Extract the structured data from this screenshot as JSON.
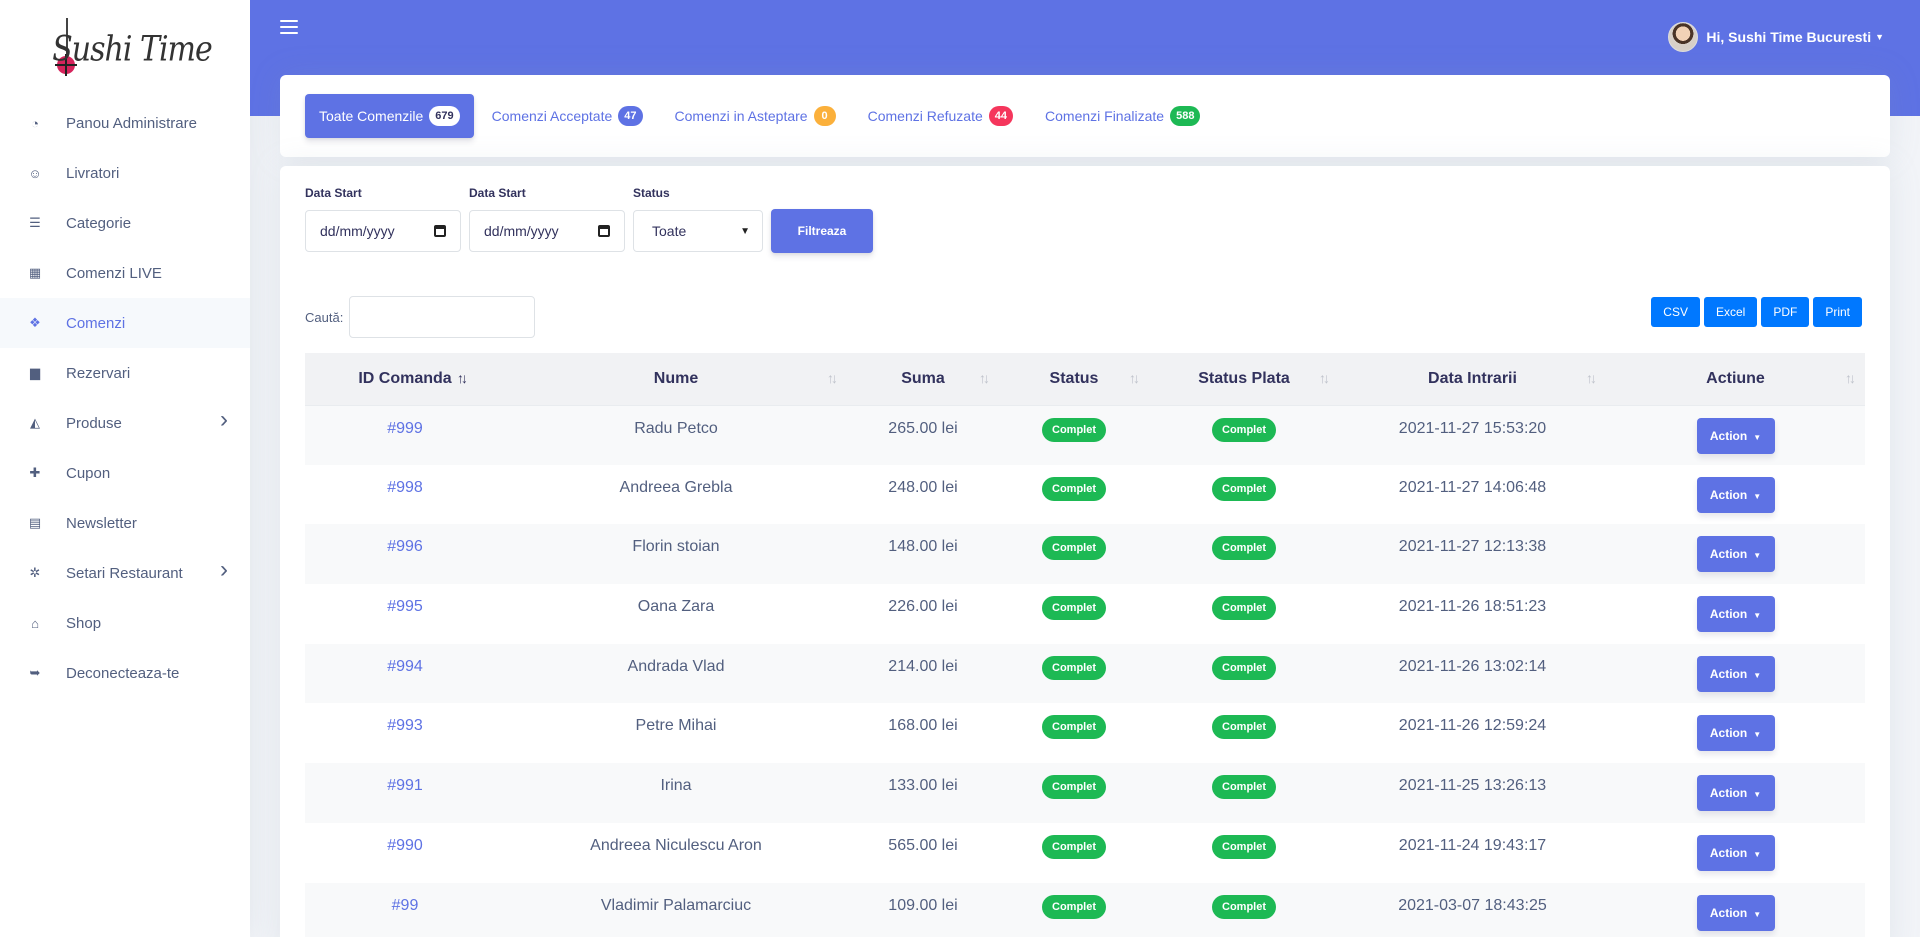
{
  "brand": {
    "logo_text": "Sushi Time"
  },
  "sidebar": {
    "items": [
      {
        "label": "Panou Administrare",
        "icon": "dashboard-icon",
        "glyph": "◔"
      },
      {
        "label": "Livratori",
        "icon": "user-icon",
        "glyph": "☺"
      },
      {
        "label": "Categorie",
        "icon": "list-icon",
        "glyph": "☰"
      },
      {
        "label": "Comenzi LIVE",
        "icon": "grid-icon",
        "glyph": "▦"
      },
      {
        "label": "Comenzi",
        "icon": "cubes-icon",
        "glyph": "❖",
        "active": true
      },
      {
        "label": "Rezervari",
        "icon": "calendar-icon",
        "glyph": "▆"
      },
      {
        "label": "Produse",
        "icon": "pizza-icon",
        "glyph": "◭",
        "chevron": true
      },
      {
        "label": "Cupon",
        "icon": "gift-icon",
        "glyph": "✚"
      },
      {
        "label": "Newsletter",
        "icon": "newspaper-icon",
        "glyph": "▤"
      },
      {
        "label": "Setari Restaurant",
        "icon": "gears-icon",
        "glyph": "✲",
        "chevron": true
      },
      {
        "label": "Shop",
        "icon": "store-icon",
        "glyph": "⌂"
      },
      {
        "label": "Deconecteaza-te",
        "icon": "logout-icon",
        "glyph": "➥"
      }
    ]
  },
  "header": {
    "user_greeting": "Hi, Sushi Time Bucuresti"
  },
  "tabs": [
    {
      "label": "Toate Comenzile",
      "count": "679",
      "color": "#ffffff",
      "active": true
    },
    {
      "label": "Comenzi Acceptate",
      "count": "47",
      "color": "#5e72e4"
    },
    {
      "label": "Comenzi in Asteptare",
      "count": "0",
      "color": "#fbb03b"
    },
    {
      "label": "Comenzi Refuzate",
      "count": "44",
      "color": "#f5365c"
    },
    {
      "label": "Comenzi Finalizate",
      "count": "588",
      "color": "#1db954"
    }
  ],
  "filters": {
    "start_label": "Data Start",
    "end_label": "Data Start",
    "date_placeholder": "dd/mm/yyyy",
    "status_label": "Status",
    "status_value": "Toate",
    "submit_label": "Filtreaza"
  },
  "search": {
    "label": "Caută:"
  },
  "export_buttons": [
    "CSV",
    "Excel",
    "PDF",
    "Print"
  ],
  "table": {
    "columns": [
      "ID Comanda",
      "Nume",
      "Suma",
      "Status",
      "Status Plata",
      "Data Intrarii",
      "Actiune"
    ],
    "action_label": "Action",
    "rows": [
      {
        "id": "#999",
        "name": "Radu Petco",
        "sum": "265.00 lei",
        "status": "Complet",
        "pay": "Complet",
        "date": "2021-11-27 15:53:20"
      },
      {
        "id": "#998",
        "name": "Andreea Grebla",
        "sum": "248.00 lei",
        "status": "Complet",
        "pay": "Complet",
        "date": "2021-11-27 14:06:48"
      },
      {
        "id": "#996",
        "name": "Florin stoian",
        "sum": "148.00 lei",
        "status": "Complet",
        "pay": "Complet",
        "date": "2021-11-27 12:13:38"
      },
      {
        "id": "#995",
        "name": "Oana Zara",
        "sum": "226.00 lei",
        "status": "Complet",
        "pay": "Complet",
        "date": "2021-11-26 18:51:23"
      },
      {
        "id": "#994",
        "name": "Andrada Vlad",
        "sum": "214.00 lei",
        "status": "Complet",
        "pay": "Complet",
        "date": "2021-11-26 13:02:14"
      },
      {
        "id": "#993",
        "name": "Petre Mihai",
        "sum": "168.00 lei",
        "status": "Complet",
        "pay": "Complet",
        "date": "2021-11-26 12:59:24"
      },
      {
        "id": "#991",
        "name": "Irina",
        "sum": "133.00 lei",
        "status": "Complet",
        "pay": "Complet",
        "date": "2021-11-25 13:26:13"
      },
      {
        "id": "#990",
        "name": "Andreea Niculescu Aron",
        "sum": "565.00 lei",
        "status": "Complet",
        "pay": "Complet",
        "date": "2021-11-24 19:43:17"
      },
      {
        "id": "#99",
        "name": "Vladimir Palamarciuc",
        "sum": "109.00 lei",
        "status": "Complet",
        "pay": "Complet",
        "date": "2021-03-07 18:43:25"
      }
    ]
  }
}
